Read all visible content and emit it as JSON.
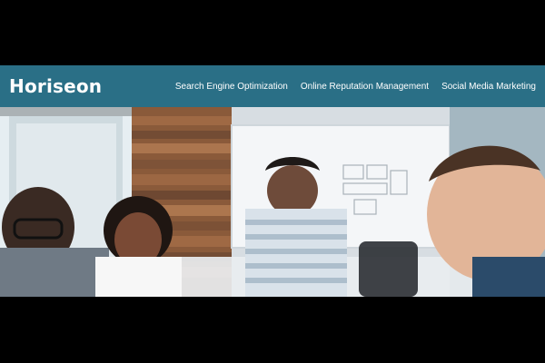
{
  "header": {
    "logo": "Horiseon",
    "nav": [
      {
        "label": "Search Engine Optimization"
      },
      {
        "label": "Online Reputation Management"
      },
      {
        "label": "Social Media Marketing"
      }
    ]
  },
  "hero": {
    "image_subject": "team meeting photo"
  },
  "colors": {
    "header_bg": "#2a6f86",
    "page_letterbox": "#000000",
    "text": "#ffffff"
  },
  "icons": {}
}
